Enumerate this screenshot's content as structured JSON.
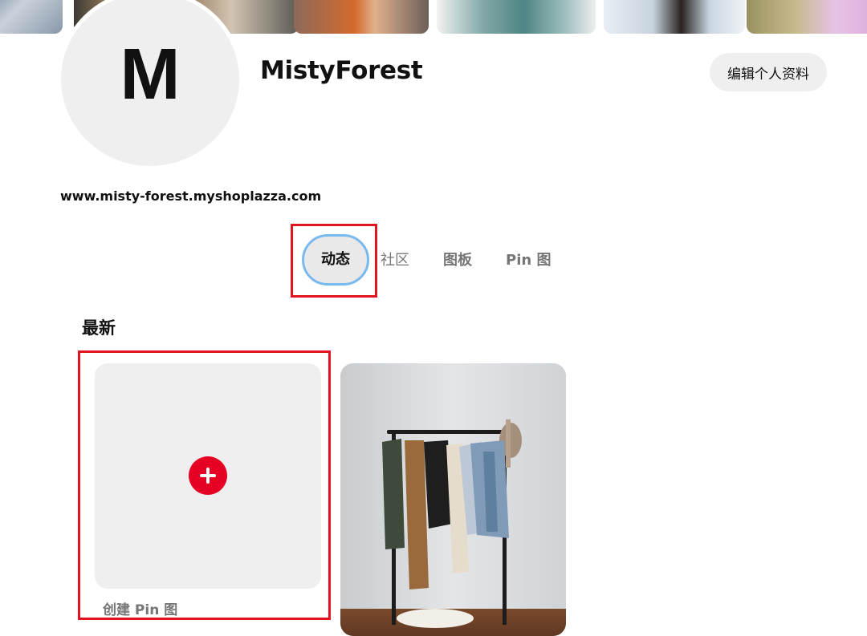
{
  "profile": {
    "avatar_letter": "M",
    "name": "MistyForest",
    "edit_button": "编辑个人资料",
    "website": "www.misty-forest.myshoplazza.com"
  },
  "tabs": [
    {
      "label": "动态",
      "active": true
    },
    {
      "label": "社区",
      "active": false
    },
    {
      "label": "图板",
      "active": false
    },
    {
      "label": "Pin 图",
      "active": false
    }
  ],
  "feed": {
    "section_title": "最新",
    "create_label": "创建 Pin 图"
  },
  "colors": {
    "accent_red": "#e60023",
    "highlight_red": "#e0141e",
    "active_tab_ring": "#78b9ee",
    "surface_gray": "#efefef"
  },
  "icons": {
    "create": "plus-icon"
  }
}
